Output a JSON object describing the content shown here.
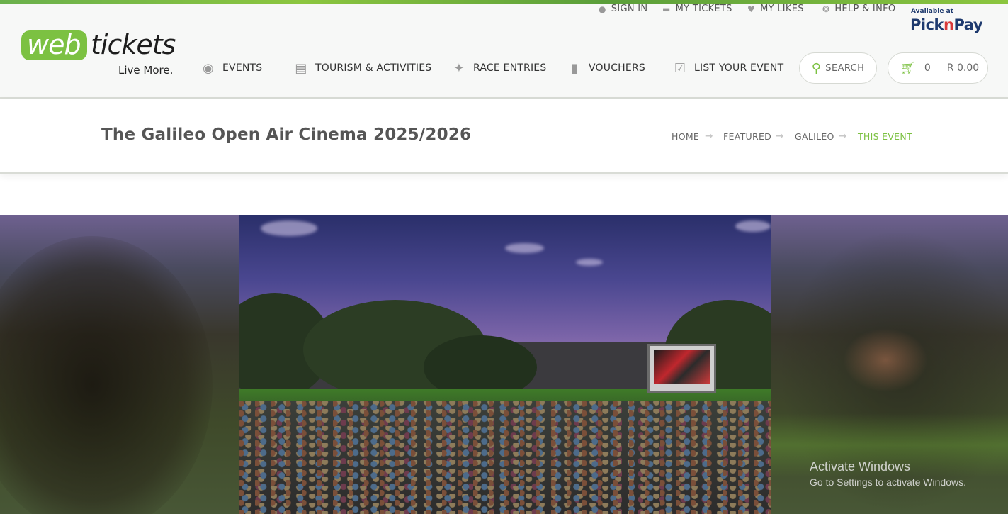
{
  "brand": {
    "logo_web": "web",
    "logo_tickets": "tickets",
    "tagline": "Live More."
  },
  "top_links": [
    {
      "label": "SIGN IN",
      "icon": "user-icon"
    },
    {
      "label": "MY TICKETS",
      "icon": "ticket-icon"
    },
    {
      "label": "MY LIKES",
      "icon": "heart-icon"
    },
    {
      "label": "HELP & INFO",
      "icon": "lifebuoy-icon"
    }
  ],
  "partner": {
    "available_at": "Available at",
    "name_part1": "Pick",
    "name_part2": "n",
    "name_part3": "Pay"
  },
  "nav": [
    {
      "label": "EVENTS",
      "icon": "binoculars-icon"
    },
    {
      "label": "TOURISM & ACTIVITIES",
      "icon": "suitcase-icon"
    },
    {
      "label": "RACE ENTRIES",
      "icon": "runner-icon"
    },
    {
      "label": "VOUCHERS",
      "icon": "bookmark-icon"
    },
    {
      "label": "LIST YOUR EVENT",
      "icon": "calendar-check-icon"
    }
  ],
  "search": {
    "label": "SEARCH"
  },
  "cart": {
    "count": "0",
    "total": "R  0.00"
  },
  "page": {
    "title": "The Galileo Open Air Cinema 2025/2026"
  },
  "breadcrumb": [
    "HOME",
    "FEATURED",
    "GALILEO",
    "THIS EVENT"
  ],
  "watermark": {
    "line1": "Activate Windows",
    "line2": "Go to Settings to activate Windows."
  },
  "colors": {
    "accent": "#7cc142",
    "pnp_blue": "#1e3a6e",
    "pnp_red": "#d93a3a"
  }
}
